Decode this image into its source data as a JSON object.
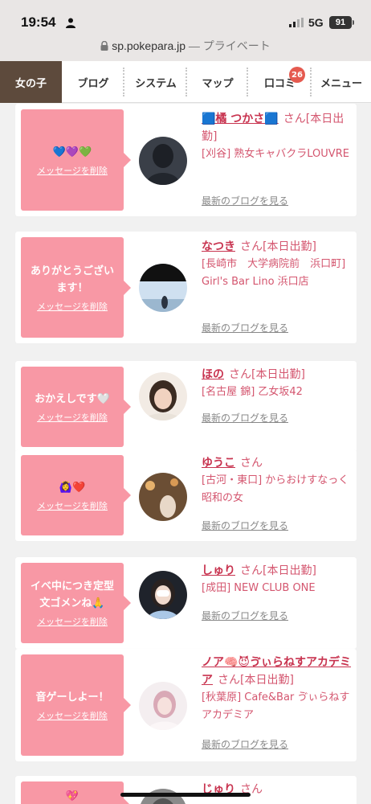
{
  "status": {
    "time": "19:54",
    "network": "5G",
    "battery": "91"
  },
  "browser": {
    "host": "sp.pokepara.jp",
    "private": " — プライベート"
  },
  "nav": {
    "tabs": [
      {
        "label": "女の子"
      },
      {
        "label": "ブログ"
      },
      {
        "label": "システム"
      },
      {
        "label": "マップ"
      },
      {
        "label": "口コミ",
        "badge": "26"
      },
      {
        "label": "メニュー"
      }
    ]
  },
  "common": {
    "delete_label": "メッセージを削除",
    "blog_label": "最新のブログを見る",
    "san": "さん"
  },
  "messages": [
    {
      "message": "💙💜💚",
      "name": "🟦橘 つかさ🟦",
      "status": "[本日出勤]",
      "shop": "[刈谷] 熟女キャバクラLOUVRE"
    },
    {
      "message": "ありがとうございます！",
      "name": "なつき",
      "status": "[本日出勤]",
      "shop": "[長崎市　大学病院前　浜口町] Girl's Bar Lino 浜口店"
    },
    {
      "message": "おかえしです🤍",
      "name": "ほの",
      "status": "[本日出勤]",
      "shop": "[名古屋 錦] 乙女坂42"
    },
    {
      "message": "🙆‍♀️❤️",
      "name": "ゆうこ",
      "status": "",
      "shop": "[古河・東口] からおけすなっく 昭和の女"
    },
    {
      "message": "イベ中につき定型文ゴメンね🙏",
      "name": "しゅり",
      "status": "[本日出勤]",
      "shop": "[成田] NEW CLUB ONE"
    },
    {
      "message": "音ゲーしよー！",
      "name": "ノア🧠😈ゔぃらねすアカデミア",
      "status": "[本日出勤]",
      "shop": "[秋葉原] Cafe&Bar ゔぃらねすアカデミア"
    },
    {
      "message": "💖",
      "name": "じゅり",
      "status": "",
      "shop": ""
    }
  ],
  "colors": {
    "bubble": "#f898a5",
    "name": "#c8334f",
    "active_tab": "#5d4a3c",
    "badge": "#e55a4f"
  }
}
